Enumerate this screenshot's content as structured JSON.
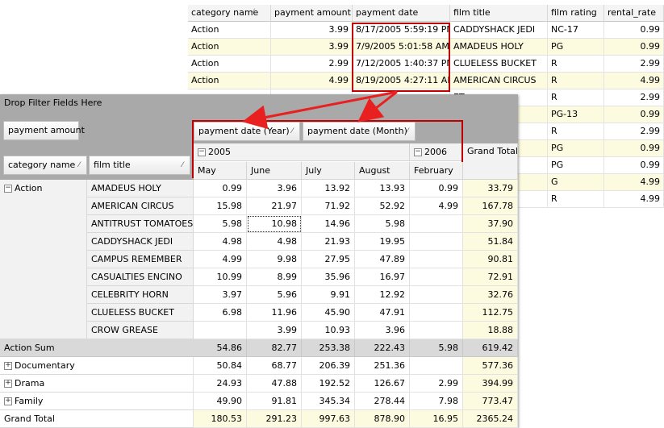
{
  "data_grid": {
    "columns": [
      {
        "label": "category name",
        "filter": true
      },
      {
        "label": "payment amount",
        "filter": false
      },
      {
        "label": "payment date",
        "filter": false
      },
      {
        "label": "film title",
        "filter": false
      },
      {
        "label": "film rating",
        "filter": false
      },
      {
        "label": "rental_rate",
        "filter": false
      }
    ],
    "rows": [
      [
        "Action",
        "3.99",
        "8/17/2005 5:59:19 PM",
        "CADDYSHACK JEDI",
        "NC-17",
        "0.99"
      ],
      [
        "Action",
        "3.99",
        "7/9/2005 5:01:58 AM",
        "AMADEUS HOLY",
        "PG",
        "0.99"
      ],
      [
        "Action",
        "2.99",
        "7/12/2005 1:40:37 PM",
        "CLUELESS BUCKET",
        "R",
        "2.99"
      ],
      [
        "Action",
        "4.99",
        "8/19/2005 4:27:11 AM",
        "AMERICAN CIRCUS",
        "R",
        "4.99"
      ],
      [
        "",
        "",
        "",
        "ET",
        "R",
        "2.99"
      ],
      [
        "",
        "",
        "",
        "N",
        "PG-13",
        "0.99"
      ],
      [
        "",
        "",
        "",
        "BER",
        "R",
        "2.99"
      ],
      [
        "",
        "",
        "",
        "",
        "PG",
        "0.99"
      ],
      [
        "",
        "",
        "",
        "",
        "PG",
        "0.99"
      ],
      [
        "",
        "",
        "",
        "CINO",
        "G",
        "4.99"
      ],
      [
        "",
        "",
        "",
        "US",
        "R",
        "4.99"
      ]
    ]
  },
  "pivot": {
    "drop_filter_label": "Drop Filter Fields Here",
    "data_field": "payment amount",
    "column_fields": [
      "payment date (Year)",
      "payment date (Month)"
    ],
    "row_fields": [
      "category name",
      "film title"
    ],
    "years": [
      {
        "label": "2005",
        "toggle": "−"
      },
      {
        "label": "2006",
        "toggle": "−"
      }
    ],
    "months": [
      "May",
      "June",
      "July",
      "August",
      "February"
    ],
    "grand_total_label": "Grand Total",
    "action_group": {
      "label": "Action",
      "toggle": "−",
      "films": [
        {
          "title": "AMADEUS HOLY",
          "values": [
            "0.99",
            "3.96",
            "13.92",
            "13.93",
            "0.99"
          ],
          "total": "33.79"
        },
        {
          "title": "AMERICAN CIRCUS",
          "values": [
            "15.98",
            "21.97",
            "71.92",
            "52.92",
            "4.99"
          ],
          "total": "167.78"
        },
        {
          "title": "ANTITRUST TOMATOES",
          "values": [
            "5.98",
            "10.98",
            "14.96",
            "5.98",
            ""
          ],
          "total": "37.90"
        },
        {
          "title": "CADDYSHACK JEDI",
          "values": [
            "4.98",
            "4.98",
            "21.93",
            "19.95",
            ""
          ],
          "total": "51.84"
        },
        {
          "title": "CAMPUS REMEMBER",
          "values": [
            "4.99",
            "9.98",
            "27.95",
            "47.89",
            ""
          ],
          "total": "90.81"
        },
        {
          "title": "CASUALTIES ENCINO",
          "values": [
            "10.99",
            "8.99",
            "35.96",
            "16.97",
            ""
          ],
          "total": "72.91"
        },
        {
          "title": "CELEBRITY HORN",
          "values": [
            "3.97",
            "5.96",
            "9.91",
            "12.92",
            ""
          ],
          "total": "32.76"
        },
        {
          "title": "CLUELESS BUCKET",
          "values": [
            "6.98",
            "11.96",
            "45.90",
            "47.91",
            ""
          ],
          "total": "112.75"
        },
        {
          "title": "CROW GREASE",
          "values": [
            "",
            "3.99",
            "10.93",
            "3.96",
            ""
          ],
          "total": "18.88"
        }
      ],
      "sum": {
        "label": "Action Sum",
        "values": [
          "54.86",
          "82.77",
          "253.38",
          "222.43",
          "5.98"
        ],
        "total": "619.42"
      }
    },
    "other_groups": [
      {
        "label": "Documentary",
        "toggle": "+",
        "values": [
          "50.84",
          "68.77",
          "206.39",
          "251.36",
          ""
        ],
        "total": "577.36"
      },
      {
        "label": "Drama",
        "toggle": "+",
        "values": [
          "24.93",
          "47.88",
          "192.52",
          "126.67",
          "2.99"
        ],
        "total": "394.99"
      },
      {
        "label": "Family",
        "toggle": "+",
        "values": [
          "49.90",
          "91.81",
          "345.34",
          "278.44",
          "7.98"
        ],
        "total": "773.47"
      }
    ],
    "grand_total": {
      "label": "Grand Total",
      "values": [
        "180.53",
        "291.23",
        "997.63",
        "878.90",
        "16.95"
      ],
      "total": "2365.24"
    }
  },
  "colors": {
    "highlight_box": "#c00000",
    "arrow": "#e82020",
    "alt_row": "#fcfadf",
    "header_band": "#a9a9a9",
    "sum_row": "#d9d9d9"
  },
  "icons": [
    "filter-icon",
    "collapse-icon",
    "expand-icon",
    "arrow-annotation"
  ]
}
